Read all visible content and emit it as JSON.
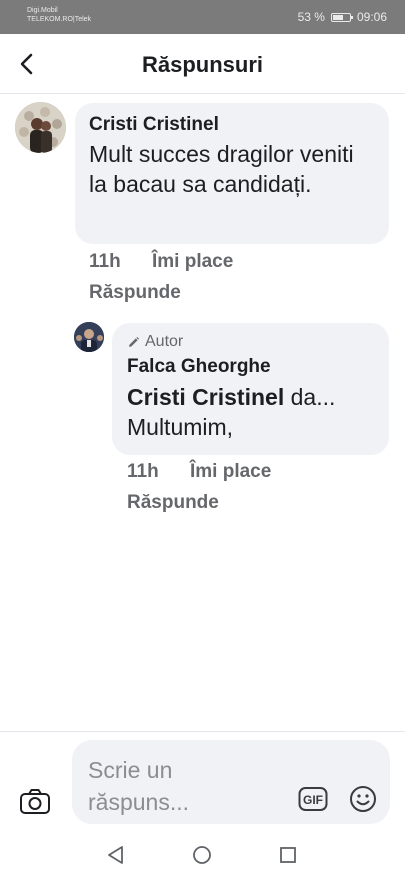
{
  "status_bar": {
    "carrier_line1": "Digi.Mobil",
    "carrier_line2": "TELEKOM.RO|Telek",
    "battery": "53 %",
    "battery_level": 0.53,
    "time": "09:06"
  },
  "header": {
    "title": "Răspunsuri",
    "back_icon": "chevron-left-icon"
  },
  "comment": {
    "author": "Cristi Cristinel",
    "text": "Mult succes dragilor veniti la bacau sa candidați.",
    "time": "11h",
    "like_label": "Îmi place",
    "reply_label": "Răspunde"
  },
  "reply": {
    "badge_label": "Autor",
    "author": "Falca Gheorghe",
    "mention": "Cristi Cristinel",
    "text_after_mention": " da...",
    "text_line2": "Multumim,",
    "time": "11h",
    "like_label": "Îmi place",
    "reply_label": "Răspunde"
  },
  "composer": {
    "placeholder": "Scrie un răspuns...",
    "gif_label": "GIF"
  },
  "colors": {
    "bubble": "#f0f2f5",
    "text": "#1c1e21",
    "secondary": "#65676b",
    "status_bar": "#7b7b7b"
  }
}
